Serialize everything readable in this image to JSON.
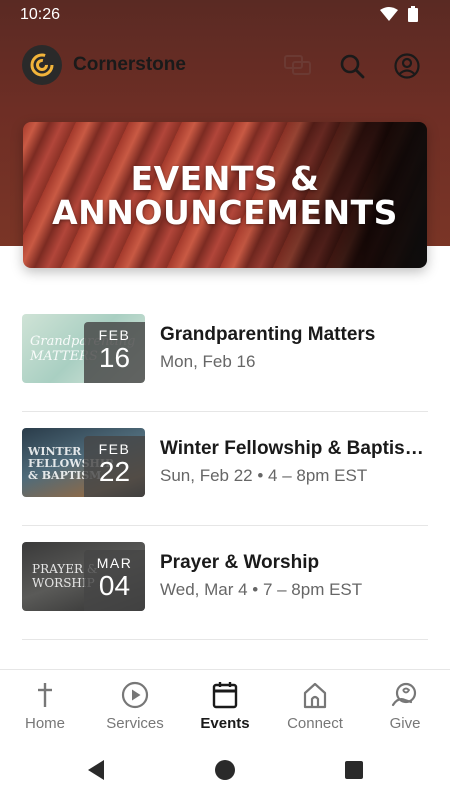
{
  "status_bar": {
    "time": "10:26"
  },
  "app_bar": {
    "title": "Cornerstone"
  },
  "banner": {
    "title_line1": "EVENTS &",
    "title_line2": "ANNOUNCEMENTS"
  },
  "events": [
    {
      "title": "Grandparenting Matters",
      "subtitle": "Mon, Feb 16",
      "month": "FEB",
      "day": "16",
      "thumb_text": "Grandparenting MATTERS"
    },
    {
      "title": "Winter Fellowship & Baptis…",
      "subtitle": "Sun, Feb 22 • 4 – 8pm EST",
      "month": "FEB",
      "day": "22",
      "thumb_text": "WINTER FELLOWSHIP & BAPTISM"
    },
    {
      "title": "Prayer & Worship",
      "subtitle": "Wed, Mar 4 • 7 – 8pm EST",
      "month": "MAR",
      "day": "04",
      "thumb_text": "PRAYER & WORSHIP"
    }
  ],
  "bottom_nav": [
    {
      "label": "Home",
      "icon": "cross-icon"
    },
    {
      "label": "Services",
      "icon": "play-circle-icon"
    },
    {
      "label": "Events",
      "icon": "calendar-icon",
      "active": true
    },
    {
      "label": "Connect",
      "icon": "church-icon"
    },
    {
      "label": "Give",
      "icon": "give-icon"
    }
  ],
  "colors": {
    "accent": "#1a1a1a",
    "header_bg": "#6e2e25",
    "muted": "#777777"
  }
}
